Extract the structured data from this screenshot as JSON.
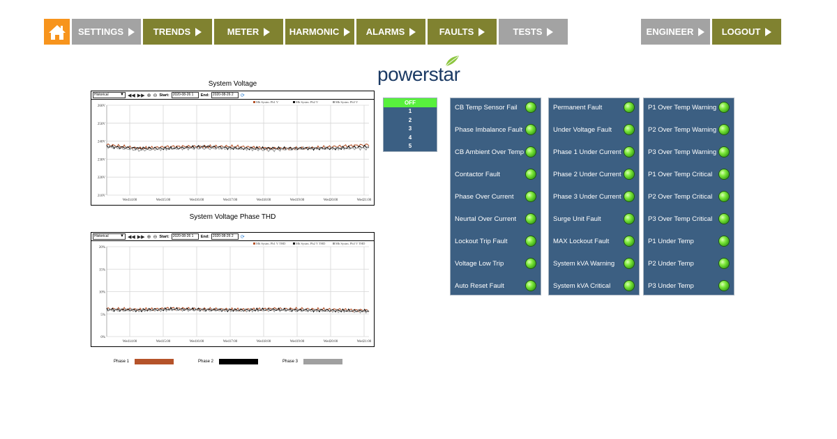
{
  "nav": {
    "home_icon": "home-icon",
    "buttons": [
      {
        "label": "SETTINGS",
        "color": "#a3a3a3"
      },
      {
        "label": "TRENDS",
        "color": "#808230"
      },
      {
        "label": "METER",
        "color": "#808230"
      },
      {
        "label": "HARMONIC",
        "color": "#808230"
      },
      {
        "label": "ALARMS",
        "color": "#808230"
      },
      {
        "label": "FAULTS",
        "color": "#808230"
      },
      {
        "label": "TESTS",
        "color": "#a3a3a3"
      },
      {
        "label": "ENGINEER",
        "color": "#a3a3a3"
      },
      {
        "label": "LOGOUT",
        "color": "#808230"
      }
    ]
  },
  "logo": {
    "text": "powerstar"
  },
  "charts": {
    "voltage": {
      "title": "System Voltage",
      "select": "Historical",
      "start_label": "Start:",
      "start_value": "2020-08-26 1",
      "end_label": "End:",
      "end_value": "2020-08-26 2",
      "legend": [
        "Mb Systm. Ph1 V",
        "Mb Systm. Ph2 V",
        "Mb Systm. Ph3 V"
      ]
    },
    "thd": {
      "title": "System Voltage Phase THD",
      "select": "Historical",
      "start_label": "Start:",
      "start_value": "2020-08-26 1",
      "end_label": "End:",
      "end_value": "2020-08-26 2",
      "legend": [
        "Mb Systm. Ph1 V THD",
        "Mb Systm. Ph2 V THD",
        "Mb Systm. Ph3 V THD"
      ]
    }
  },
  "chart_data": [
    {
      "type": "line",
      "title": "System Voltage",
      "x": [
        "Wed14:00",
        "Wed15:00",
        "Wed16:00",
        "Wed17:00",
        "Wed18:00",
        "Wed19:00",
        "Wed20:00",
        "Wed21:00"
      ],
      "yticks": [
        "210V",
        "220V",
        "230V",
        "240V",
        "250V",
        "260V"
      ],
      "ylim": [
        210,
        260
      ],
      "series": [
        {
          "name": "Mb Systm. Ph1 V",
          "values": [
            238,
            236,
            237,
            237,
            237,
            236,
            236,
            237,
            238
          ],
          "color": "#b5532a"
        },
        {
          "name": "Mb Systm. Ph2 V",
          "values": [
            237,
            236,
            236,
            237,
            236,
            236,
            236,
            236,
            237
          ],
          "color": "#111111"
        },
        {
          "name": "Mb Systm. Ph3 V",
          "values": [
            237,
            235,
            236,
            236,
            236,
            235,
            236,
            236,
            236
          ],
          "color": "#9e9e9e"
        }
      ],
      "grid": true
    },
    {
      "type": "line",
      "title": "System Voltage Phase THD",
      "x": [
        "Wed14:00",
        "Wed15:00",
        "Wed16:00",
        "Wed17:00",
        "Wed18:00",
        "Wed19:00",
        "Wed20:00",
        "Wed21:00"
      ],
      "yticks": [
        "0%",
        "5%",
        "10%",
        "15%",
        "20%"
      ],
      "ylim": [
        0,
        20
      ],
      "series": [
        {
          "name": "Mb Systm. Ph1 V THD",
          "values": [
            6.2,
            6.0,
            6.3,
            6.1,
            6.0,
            6.2,
            6.1,
            6.0,
            5.8
          ],
          "color": "#b5532a"
        },
        {
          "name": "Mb Systm. Ph2 V THD",
          "values": [
            6.0,
            5.9,
            6.1,
            6.0,
            5.9,
            6.0,
            5.9,
            5.8,
            5.7
          ],
          "color": "#111111"
        },
        {
          "name": "Mb Systm. Ph3 V THD",
          "values": [
            5.9,
            5.8,
            6.0,
            5.9,
            5.8,
            5.9,
            5.8,
            5.7,
            5.6
          ],
          "color": "#9e9e9e"
        }
      ],
      "grid": true
    }
  ],
  "bottom_legend": [
    {
      "label": "Phase 1",
      "color": "#b5532a"
    },
    {
      "label": "Phase 2",
      "color": "#000000"
    },
    {
      "label": "Phase 3",
      "color": "#a0a0a0"
    }
  ],
  "listbox": {
    "selected": "OFF",
    "options": [
      "1",
      "2",
      "3",
      "4",
      "5"
    ]
  },
  "panels": [
    {
      "items": [
        "CB Temp Sensor Fail",
        "Phase Imbalance Fault",
        "CB Ambient Over Temp",
        "Contactor Fault",
        "Phase Over Current",
        "Neurtal Over Current",
        "Lockout Trip Fault",
        "Voltage Low Trip",
        "Auto Reset Fault"
      ]
    },
    {
      "items": [
        "Permanent Fault",
        "Under Voltage Fault",
        "Phase 1 Under Current",
        "Phase 2 Under Current",
        "Phase 3 Under Current",
        "Surge Unit Fault",
        "MAX Lockout Fault",
        "System kVA Warning",
        "System kVA Critical"
      ]
    },
    {
      "items": [
        "P1 Over Temp Warning",
        "P2 Over Temp Warning",
        "P3 Over Temp Warning",
        "P1 Over Temp Critical",
        "P2 Over Temp Critical",
        "P3 Over Temp Critical",
        "P1 Under Temp",
        "P2 Under Temp",
        "P3 Under Temp"
      ]
    }
  ],
  "colors": {
    "panel": "#3c5f82",
    "led": "#5fd42a",
    "olive": "#808230",
    "grey": "#a3a3a3",
    "home": "#f7941d"
  }
}
